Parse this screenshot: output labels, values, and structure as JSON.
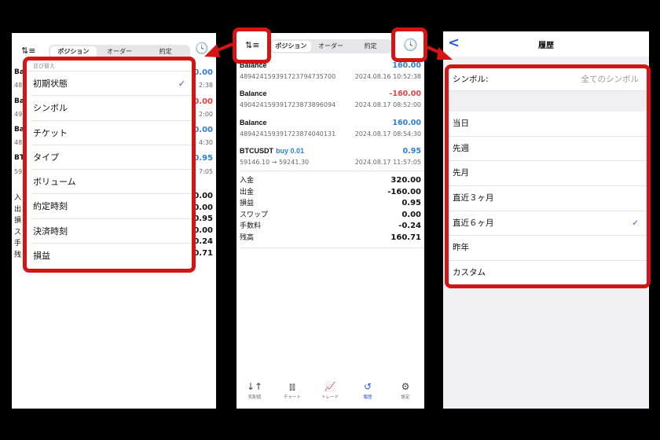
{
  "tabs": [
    "ポジション",
    "オーダー",
    "約定"
  ],
  "records": [
    {
      "title": "Balance",
      "sub": "4894241593917237947357 00",
      "id": "4894241593917237947357 00",
      "time": "2024.08.16 10:52:38",
      "value": "160.00",
      "color": "blue"
    },
    {
      "title": "Balance",
      "id": "490424159391723873896094",
      "time": "2024.08.17 08:52:00",
      "value": "-160.00",
      "color": "red"
    },
    {
      "title": "Balance",
      "id": "489424159391723874040131",
      "time": "2024.08.17 08:54:30",
      "value": "160.00",
      "color": "blue"
    },
    {
      "title": "BTCUSDT",
      "extra": "buy 0.01",
      "id": "59146.10 → 59241.30",
      "time": "2024.08.17 11:57:05",
      "value": "0.95",
      "color": "blue"
    }
  ],
  "first_id": "489424159391723794735700",
  "summary": [
    {
      "label": "入金",
      "value": "320.00"
    },
    {
      "label": "出金",
      "value": "-160.00"
    },
    {
      "label": "損益",
      "value": "0.95"
    },
    {
      "label": "スワップ",
      "value": "0.00"
    },
    {
      "label": "手数料",
      "value": "-0.24"
    },
    {
      "label": "残高",
      "value": "160.71"
    }
  ],
  "sort_menu": {
    "header": "並び替え",
    "items": [
      "初期状態",
      "シンボル",
      "チケット",
      "タイプ",
      "ボリューム",
      "約定時刻",
      "決済時刻",
      "損益"
    ],
    "selected": "初期状態"
  },
  "left_peek": {
    "values": [
      "0.00",
      "2:38",
      "0.00",
      "2:00",
      "0.00",
      "4:30",
      "0.95",
      "7:05"
    ],
    "titles": [
      "Ba",
      "48",
      "Ba",
      "49",
      "Ba",
      "48",
      "BT",
      "59"
    ],
    "summary": [
      "入",
      "出",
      "損",
      "ス",
      "手",
      "残"
    ],
    "sumvals": [
      "0.00",
      "0.00",
      "0.95",
      "0.00",
      "0.24",
      "0.71"
    ]
  },
  "bottom_nav": [
    {
      "label": "気配値",
      "icon": "arrows-updown-icon",
      "glyph": "↓↑"
    },
    {
      "label": "チャート",
      "icon": "candlestick-icon",
      "glyph": "⫾⫾"
    },
    {
      "label": "トレード",
      "icon": "trade-chart-icon",
      "glyph": "📈"
    },
    {
      "label": "履歴",
      "icon": "history-icon",
      "glyph": "↺",
      "active": true
    },
    {
      "label": "設定",
      "icon": "gear-icon",
      "glyph": "⚙"
    }
  ],
  "history": {
    "title": "履歴",
    "back": "<",
    "symbol_label": "シンボル:",
    "symbol_value": "全てのシンボル",
    "periods": [
      "当日",
      "先週",
      "先月",
      "直近３ヶ月",
      "直近６ヶ月",
      "昨年",
      "カスタム"
    ],
    "selected": "直近６ヶ月"
  },
  "colors": {
    "accent": "#2a5bd7",
    "highlight": "#d51414",
    "positive": "#2f7fd6",
    "negative": "#d44444"
  }
}
